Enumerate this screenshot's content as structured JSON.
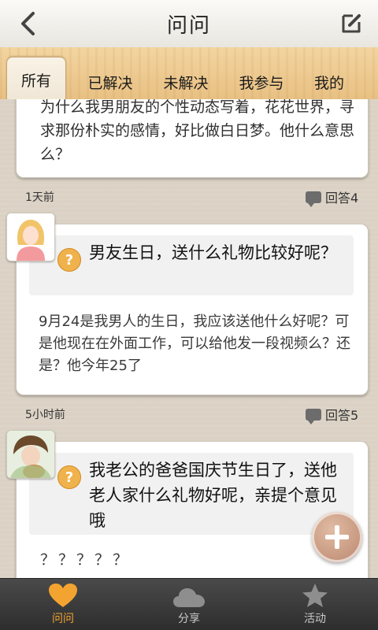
{
  "header": {
    "title": "问问",
    "back_icon": "back-arrow-icon",
    "edit_icon": "compose-icon"
  },
  "tabs": [
    {
      "label": "所有",
      "active": true
    },
    {
      "label": "已解决",
      "active": false
    },
    {
      "label": "未解决",
      "active": false
    },
    {
      "label": "我参与",
      "active": false
    },
    {
      "label": "我的",
      "active": false
    }
  ],
  "posts": [
    {
      "title": "",
      "body": "为什么我男朋友的个性动态写着，花花世界，寻求那份朴实的感情，好比做白日梦。他什么意思么？",
      "time": "1天前",
      "answers": "回答4"
    },
    {
      "title": "男友生日，送什么礼物比较好呢？",
      "body": "9月24是我男人的生日，我应该送他什么好呢？可是他现在在外面工作，可以给他发一段视频么？还是？他今年25了",
      "time": "5小时前",
      "answers": "回答5"
    },
    {
      "title": "我老公的爸爸国庆节生日了，送他老人家什么礼物好呢，亲提个意见哦",
      "body": "？？？？？"
    }
  ],
  "fab": {
    "icon": "plus-icon"
  },
  "bottom_nav": [
    {
      "label": "问问",
      "icon": "heart-icon",
      "active": true
    },
    {
      "label": "分享",
      "icon": "cloud-icon",
      "active": false
    },
    {
      "label": "活动",
      "icon": "star-icon",
      "active": false
    }
  ],
  "colors": {
    "accent": "#f0a23a",
    "tab_wood": "#ecc88e",
    "nav_bg": "#333333",
    "question_badge": "#f0b24c"
  }
}
